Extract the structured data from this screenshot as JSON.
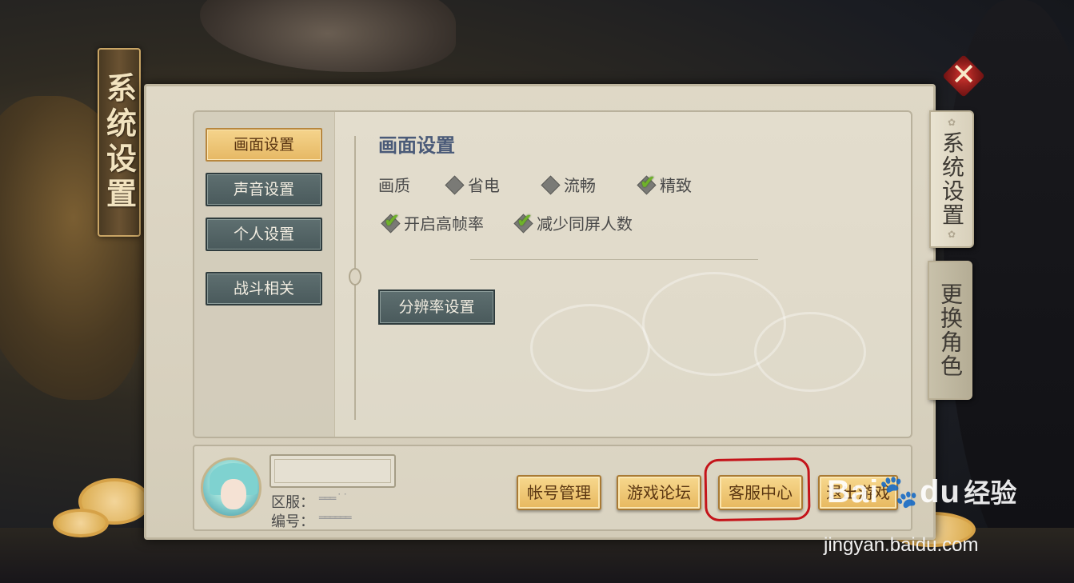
{
  "window": {
    "title": "系统设置"
  },
  "close": {
    "icon": "close-icon"
  },
  "nav": {
    "items": [
      {
        "label": "画面设置",
        "active": true
      },
      {
        "label": "声音设置",
        "active": false
      },
      {
        "label": "个人设置",
        "active": false
      },
      {
        "label": "战斗相关",
        "active": false
      }
    ]
  },
  "section": {
    "title": "画面设置",
    "quality_label": "画质",
    "quality_options": [
      {
        "label": "省电",
        "checked": false
      },
      {
        "label": "流畅",
        "checked": false
      },
      {
        "label": "精致",
        "checked": true
      }
    ],
    "toggles": [
      {
        "label": "开启高帧率",
        "checked": true
      },
      {
        "label": "减少同屏人数",
        "checked": true
      }
    ],
    "resolution_button": "分辨率设置"
  },
  "profile": {
    "server_label": "区服：",
    "server_value": "═══ ˙ ˙",
    "id_label": "编号：",
    "id_value": "══════"
  },
  "footer_buttons": [
    "帐号管理",
    "游戏论坛",
    "客服中心",
    "退出游戏"
  ],
  "tabs": [
    {
      "label": "系统设置",
      "active": true
    },
    {
      "label": "更换角色",
      "active": false
    }
  ],
  "watermark": {
    "logo": "Bai",
    "logo_suffix": "du",
    "text": "经验",
    "url": "jingyan.baidu.com"
  },
  "colors": {
    "accent_gold": "#e7b85f",
    "nav_teal": "#4a5a5c",
    "check_green": "#6fb22a",
    "highlight_red": "#c4141a"
  }
}
